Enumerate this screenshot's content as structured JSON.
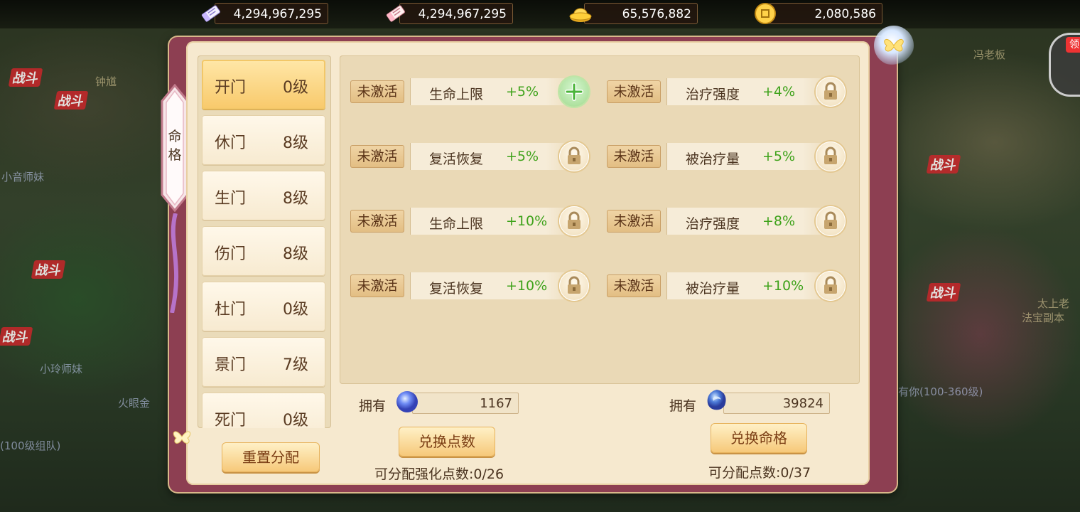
{
  "currencies": [
    {
      "icon": "scroll-ticket-icon",
      "value": "4,294,967,295"
    },
    {
      "icon": "scroll-ticket-icon",
      "value": "4,294,967,295"
    },
    {
      "icon": "gold-ingot-icon",
      "value": "65,576,882"
    },
    {
      "icon": "gold-coin-icon",
      "value": "2,080,586"
    }
  ],
  "side_tab": {
    "label_top": "命",
    "label_bottom": "格"
  },
  "right_edge": {
    "tag": "领"
  },
  "gates": [
    {
      "name": "开门",
      "level": "0级",
      "active": true
    },
    {
      "name": "休门",
      "level": "8级"
    },
    {
      "name": "生门",
      "level": "8级"
    },
    {
      "name": "伤门",
      "level": "8级"
    },
    {
      "name": "杜门",
      "level": "0级"
    },
    {
      "name": "景门",
      "level": "7级"
    },
    {
      "name": "死门",
      "level": "0级"
    }
  ],
  "reset_button": "重置分配",
  "attributes": [
    {
      "state": "未激活",
      "name": "生命上限",
      "value": "+5%",
      "action": "plus"
    },
    {
      "state": "未激活",
      "name": "治疗强度",
      "value": "+4%",
      "action": "lock"
    },
    {
      "state": "未激活",
      "name": "复活恢复",
      "value": "+5%",
      "action": "lock"
    },
    {
      "state": "未激活",
      "name": "被治疗量",
      "value": "+5%",
      "action": "lock"
    },
    {
      "state": "未激活",
      "name": "生命上限",
      "value": "+10%",
      "action": "lock"
    },
    {
      "state": "未激活",
      "name": "治疗强度",
      "value": "+8%",
      "action": "lock"
    },
    {
      "state": "未激活",
      "name": "复活恢复",
      "value": "+10%",
      "action": "lock"
    },
    {
      "state": "未激活",
      "name": "被治疗量",
      "value": "+10%",
      "action": "lock"
    }
  ],
  "resources": {
    "points": {
      "label": "拥有",
      "value": "1167",
      "button": "兑换点数",
      "note": "可分配强化点数:0/26"
    },
    "destiny": {
      "label": "拥有",
      "value": "39824",
      "button": "兑换命格",
      "note": "可分配点数:0/37"
    }
  },
  "world_labels": {
    "battle_tag": "战斗",
    "npc_1": "冯老板",
    "npc_2": "钟馗",
    "npc_3": "小音师妹",
    "npc_4": "小玲师妹",
    "npc_5": "火眼金",
    "npc_6": "太上老",
    "npc_7": "法宝副本",
    "team_1": "有你(100-360级)",
    "team_2": "(100级组队)"
  },
  "colors": {
    "panel": "#f6e9cf",
    "frame": "#8d3f52",
    "accent_green": "#3ea21a",
    "gate_active": "#f8c96a"
  }
}
